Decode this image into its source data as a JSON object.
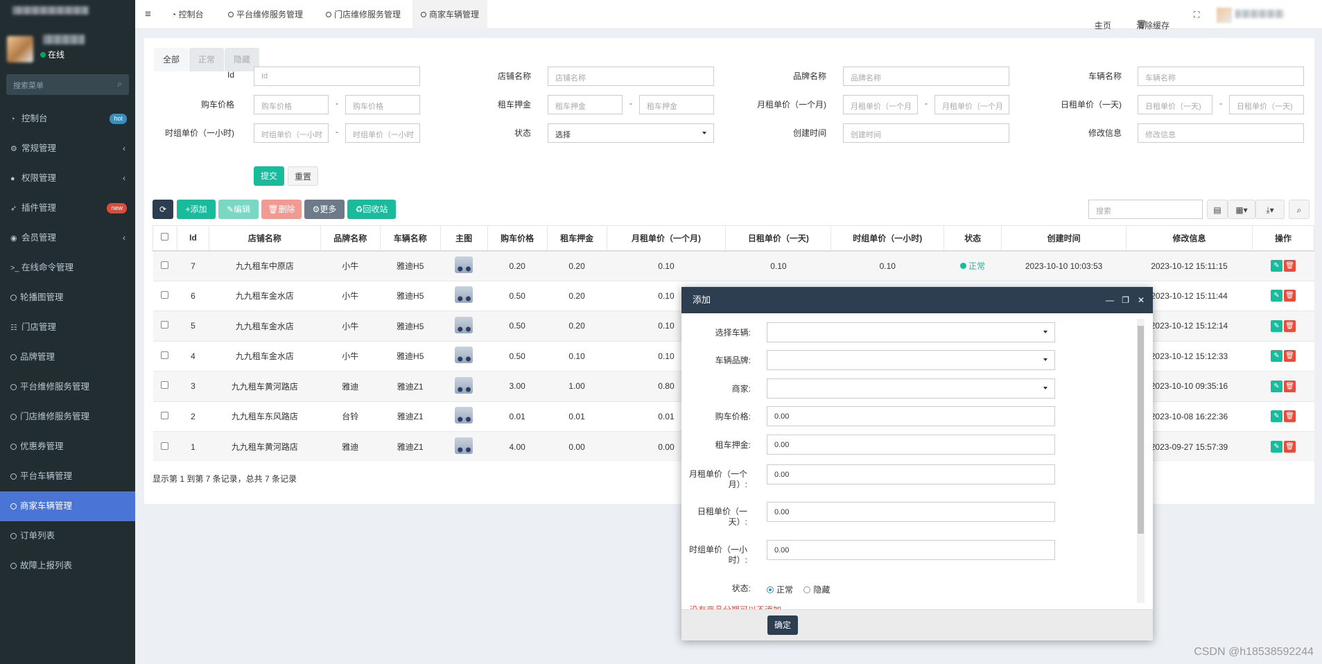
{
  "sidebar": {
    "user_status": "在线",
    "search_placeholder": "搜索菜单",
    "items": [
      {
        "label": "控制台",
        "icon": "dashboard-icon",
        "badge": "hot",
        "badge_color": "#3c8dbc"
      },
      {
        "label": "常规管理",
        "icon": "cogs-icon"
      },
      {
        "label": "权限管理",
        "icon": "group-icon"
      },
      {
        "label": "插件管理",
        "icon": "rocket-icon",
        "badge": "new",
        "badge_color": "#dd4b39"
      },
      {
        "label": "会员管理",
        "icon": "user-circle-icon"
      },
      {
        "label": "在线命令管理",
        "icon": "terminal-icon"
      },
      {
        "label": "轮播图管理",
        "icon": "circle-icon"
      },
      {
        "label": "门店管理",
        "icon": "list-icon"
      },
      {
        "label": "品牌管理",
        "icon": "circle-icon"
      },
      {
        "label": "平台维修服务管理",
        "icon": "circle-icon"
      },
      {
        "label": "门店维修服务管理",
        "icon": "circle-icon"
      },
      {
        "label": "优惠券管理",
        "icon": "circle-icon"
      },
      {
        "label": "平台车辆管理",
        "icon": "circle-icon"
      },
      {
        "label": "商家车辆管理",
        "icon": "circle-icon",
        "active": true
      },
      {
        "label": "订单列表",
        "icon": "circle-icon"
      },
      {
        "label": "故障上报列表",
        "icon": "circle-icon"
      }
    ]
  },
  "topbar": {
    "tabs": [
      "控制台",
      "平台维修服务管理",
      "门店维修服务管理",
      "商家车辆管理"
    ],
    "home": "主页",
    "clear_cache": "清除缓存"
  },
  "subtabs": [
    "全部",
    "正常",
    "隐藏"
  ],
  "filters": {
    "id_label": "Id",
    "id_ph": "Id",
    "shop_label": "店铺名称",
    "shop_ph": "店铺名称",
    "brand_label": "品牌名称",
    "brand_ph": "品牌名称",
    "vehicle_label": "车辆名称",
    "vehicle_ph": "车辆名称",
    "buy_label": "购车价格",
    "buy_ph": "购车价格",
    "deposit_label": "租车押金",
    "deposit_ph": "租车押金",
    "month_label": "月租单价（一个月)",
    "month_ph": "月租单价（一个月",
    "day_label": "日租单价（一天)",
    "day_ph": "日租单价（一天)",
    "hour_label": "时组单价（一小时)",
    "hour_ph": "时组单价（一小时",
    "status_label": "状态",
    "status_value": "选择",
    "created_label": "创建时间",
    "created_ph": "创建时间",
    "modified_label": "修改信息",
    "modified_ph": "修改信息",
    "submit": "提交",
    "reset": "重置",
    "dash": "-"
  },
  "toolbar": {
    "add": "添加",
    "edit": "编辑",
    "delete": "删除",
    "more": "更多",
    "recycle": "回收站",
    "search_ph": "搜索"
  },
  "table": {
    "headers": [
      "Id",
      "店铺名称",
      "品牌名称",
      "车辆名称",
      "主图",
      "购车价格",
      "租车押金",
      "月租单价（一个月)",
      "日租单价（一天)",
      "时组单价（一小时)",
      "状态",
      "创建时间",
      "修改信息",
      "操作"
    ],
    "rows": [
      {
        "id": "7",
        "shop": "九九租车中原店",
        "brand": "小牛",
        "vehicle": "雅迪H5",
        "buy": "0.20",
        "deposit": "0.20",
        "month": "0.10",
        "day": "0.10",
        "hour": "0.10",
        "status": "正常",
        "created": "2023-10-10 10:03:53",
        "modified": "2023-10-12 15:11:15"
      },
      {
        "id": "6",
        "shop": "九九租车金水店",
        "brand": "小牛",
        "vehicle": "雅迪H5",
        "buy": "0.50",
        "deposit": "0.20",
        "month": "0.10",
        "day": "",
        "hour": "",
        "status": "",
        "created": "",
        "modified": "2023-10-12 15:11:44"
      },
      {
        "id": "5",
        "shop": "九九租车金水店",
        "brand": "小牛",
        "vehicle": "雅迪H5",
        "buy": "0.50",
        "deposit": "0.20",
        "month": "0.10",
        "day": "",
        "hour": "",
        "status": "",
        "created": "",
        "modified": "2023-10-12 15:12:14"
      },
      {
        "id": "4",
        "shop": "九九租车金水店",
        "brand": "小牛",
        "vehicle": "雅迪H5",
        "buy": "0.50",
        "deposit": "0.10",
        "month": "0.10",
        "day": "",
        "hour": "",
        "status": "",
        "created": "",
        "modified": "2023-10-12 15:12:33"
      },
      {
        "id": "3",
        "shop": "九九租车黄河路店",
        "brand": "雅迪",
        "vehicle": "雅迪Z1",
        "buy": "3.00",
        "deposit": "1.00",
        "month": "0.80",
        "day": "",
        "hour": "",
        "status": "",
        "created": "",
        "modified": "2023-10-10 09:35:16"
      },
      {
        "id": "2",
        "shop": "九九租车东风路店",
        "brand": "台铃",
        "vehicle": "雅迪Z1",
        "buy": "0.01",
        "deposit": "0.01",
        "month": "0.01",
        "day": "",
        "hour": "",
        "status": "",
        "created": "",
        "modified": "2023-10-08 16:22:36"
      },
      {
        "id": "1",
        "shop": "九九租车黄河路店",
        "brand": "雅迪",
        "vehicle": "雅迪Z1",
        "buy": "4.00",
        "deposit": "0.00",
        "month": "0.00",
        "day": "",
        "hour": "",
        "status": "",
        "created": "",
        "modified": "2023-09-27 15:57:39"
      }
    ],
    "page_info": "显示第 1 到第 7 条记录，总共 7 条记录"
  },
  "modal": {
    "title": "添加",
    "vehicle_label": "选择车辆:",
    "brand_label": "车辆品牌:",
    "merchant_label": "商家:",
    "buy_label": "购车价格:",
    "buy_value": "0.00",
    "deposit_label": "租车押金:",
    "deposit_value": "0.00",
    "month_label": "月租单价（一个月）:",
    "month_value": "0.00",
    "day_label": "日租单价（一天）:",
    "day_value": "0.00",
    "hour_label": "时组单价（一小时）:",
    "hour_value": "0.00",
    "status_label": "状态:",
    "status_normal": "正常",
    "status_hidden": "隐藏",
    "warning": "没有商品分期可以不添加",
    "confirm": "确定"
  },
  "watermark": "CSDN @h18538592244",
  "colors": {
    "sidebar": "#222d32",
    "active": "#4a74d6",
    "green": "#18bc9c",
    "red": "#e74c3c",
    "navy": "#2c3e50"
  }
}
